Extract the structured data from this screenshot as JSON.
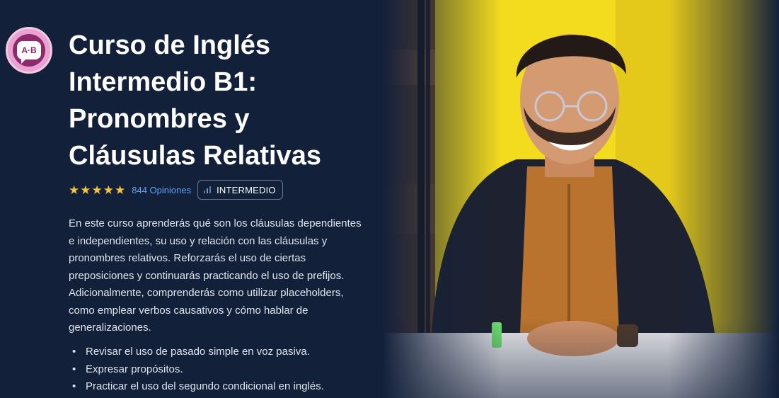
{
  "logo": {
    "text": "A·B",
    "icon": "language-chat-bubble-icon"
  },
  "course": {
    "title": "Curso de Inglés Intermedio B1: Pronombres y Cláusulas Relativas",
    "rating_stars": 5,
    "reviews_label": "844 Opiniones",
    "level": "INTERMEDIO",
    "description": "En este curso aprenderás qué son los cláusulas dependientes e independientes, su uso y relación con las cláusulas y pronombres relativos. Reforzarás el uso de ciertas preposiciones y continuarás practicando el uso de prefijos. Adicionalmente, comprenderás como utilizar placeholders, como emplear verbos causativos y cómo hablar de generalizaciones.",
    "bullets": [
      "Revisar el uso de pasado simple en voz pasiva.",
      "Expresar propósitos.",
      "Practicar el uso del segundo condicional en inglés."
    ]
  },
  "colors": {
    "background": "#13203a",
    "star": "#f6c33d",
    "link": "#5ea3f0",
    "photo_wall": "#f3db1d"
  }
}
